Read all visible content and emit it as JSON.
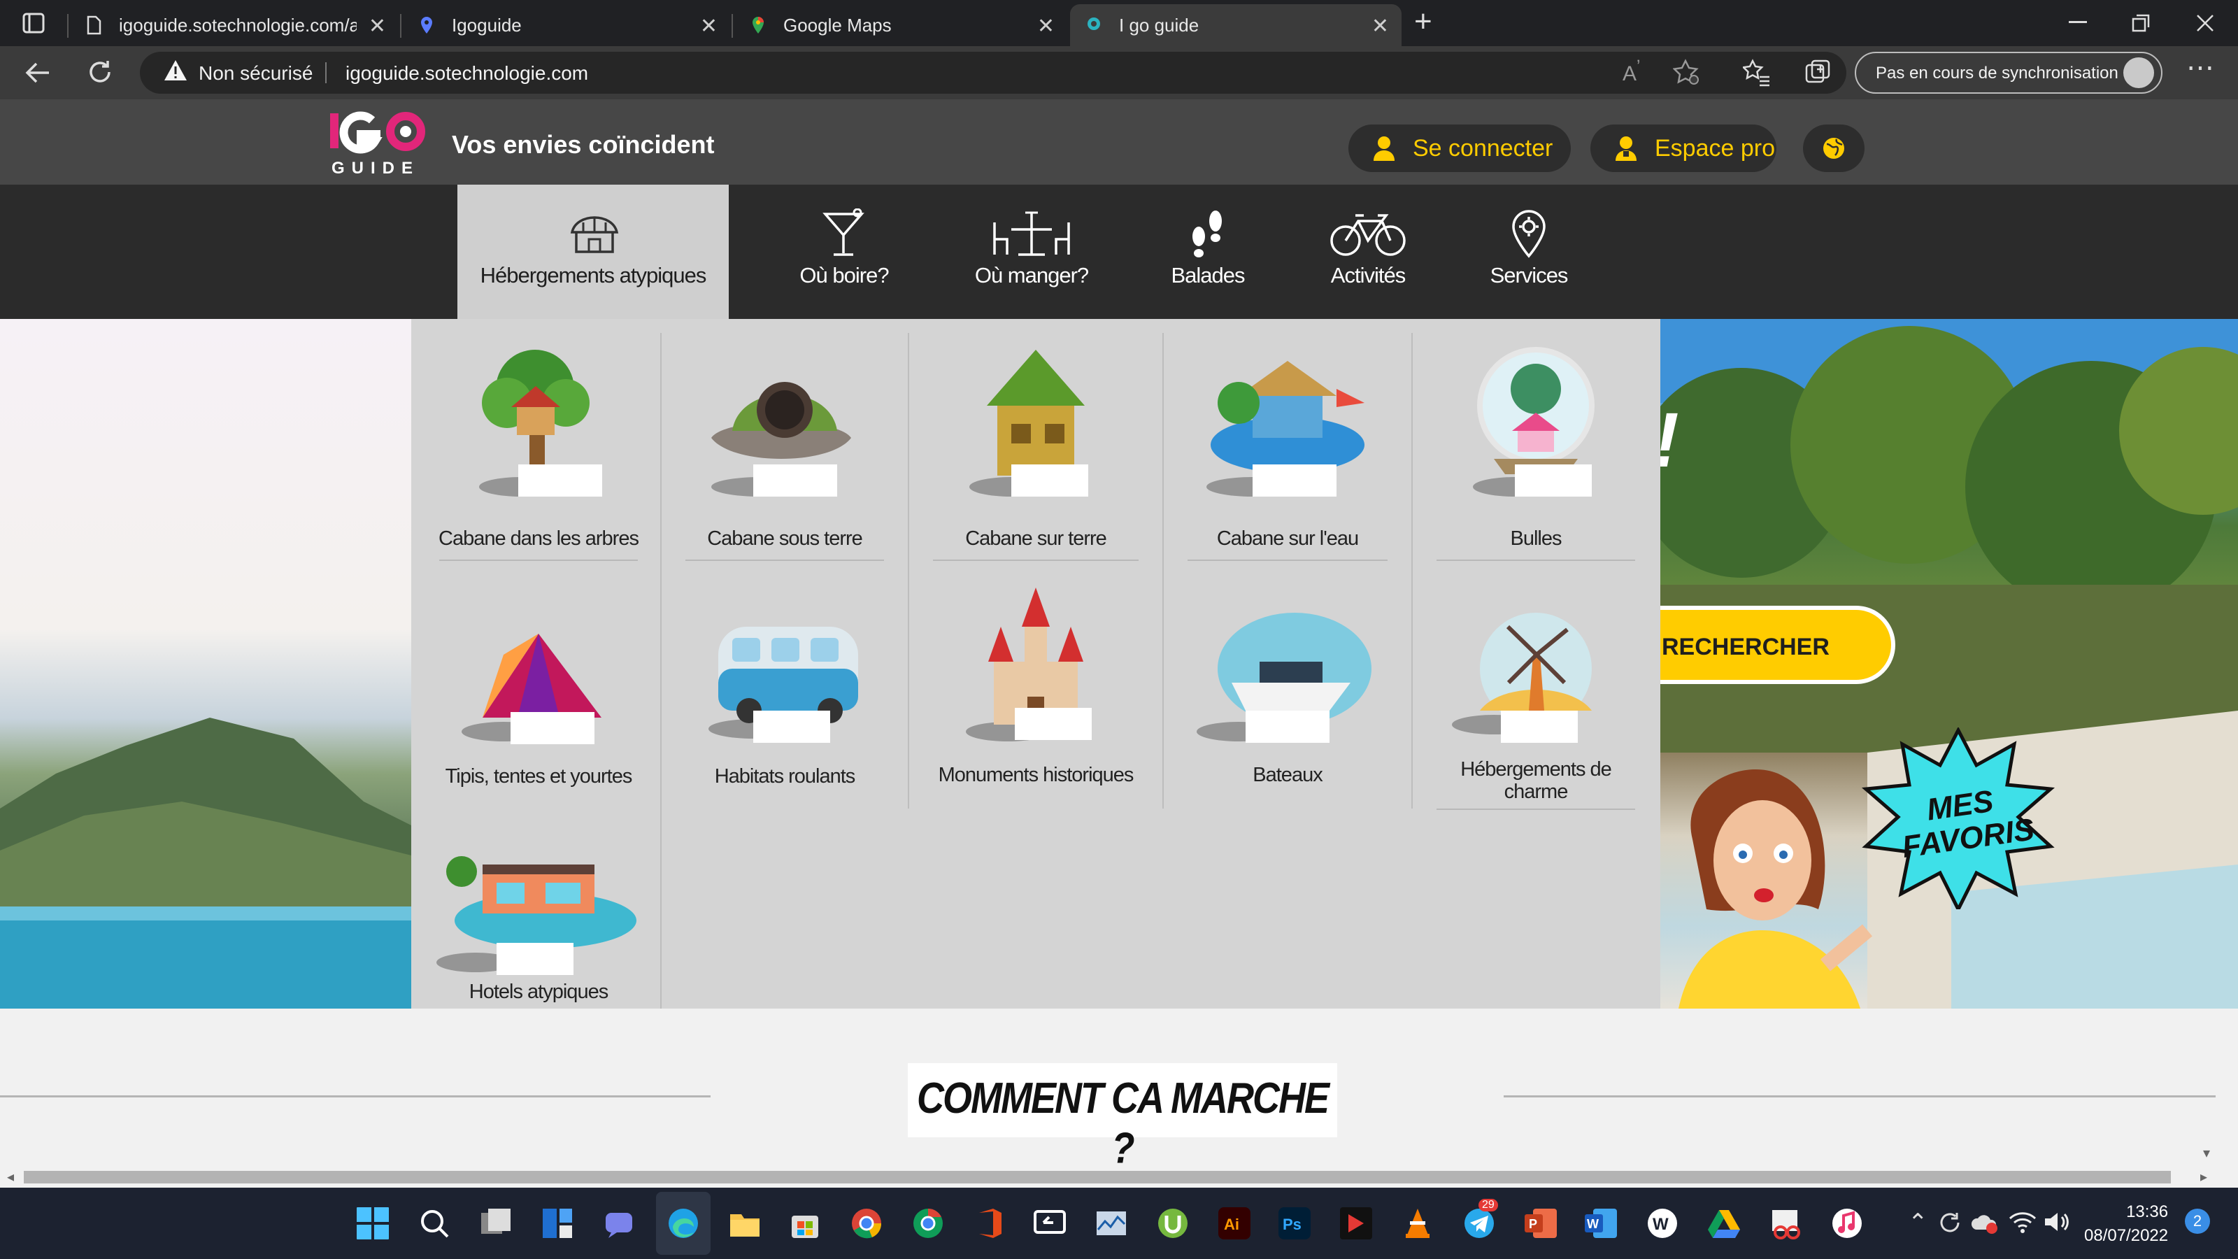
{
  "browser": {
    "tabs": [
      {
        "title": "igoguide.sotechnologie.com/ad",
        "active": false
      },
      {
        "title": "Igoguide",
        "active": false
      },
      {
        "title": "Google Maps",
        "active": false
      },
      {
        "title": "I go guide",
        "active": true
      }
    ],
    "security_label": "Non sécurisé",
    "url": "igoguide.sotechnologie.com",
    "sync_label": "Pas en cours de synchronisation",
    "new_tab_glyph": "+",
    "close_glyph": "✕"
  },
  "site": {
    "tagline": "Vos envies coïncident",
    "login_label": "Se connecter",
    "pro_label": "Espace pro",
    "accent_color": "#ffcc00",
    "nav": [
      {
        "label": "Hébergements atypiques",
        "icon": "cabin-icon",
        "active": true
      },
      {
        "label": "Où boire?",
        "icon": "cocktail-icon",
        "active": false
      },
      {
        "label": "Où manger?",
        "icon": "restaurant-table-icon",
        "active": false
      },
      {
        "label": "Balades",
        "icon": "footprints-icon",
        "active": false
      },
      {
        "label": "Activités",
        "icon": "bicycle-icon",
        "active": false
      },
      {
        "label": "Services",
        "icon": "map-pin-gear-icon",
        "active": false
      }
    ],
    "dropdown": [
      {
        "label": "Cabane dans les arbres",
        "icon": "treehouse-icon"
      },
      {
        "label": "Cabane  sous terre",
        "icon": "underground-cabin-icon"
      },
      {
        "label": "Cabane sur terre",
        "icon": "hut-icon"
      },
      {
        "label": "Cabane  sur l'eau",
        "icon": "water-cabin-icon"
      },
      {
        "label": "Bulles",
        "icon": "bubble-dome-icon"
      },
      {
        "label": "Tipis, tentes et yourtes",
        "icon": "tent-icon"
      },
      {
        "label": "Habitats roulants",
        "icon": "van-icon"
      },
      {
        "label": "Monuments historiques",
        "icon": "castle-icon"
      },
      {
        "label": "Bateaux",
        "icon": "boat-icon"
      },
      {
        "label": "Hébergements de charme",
        "icon": "windmill-icon"
      },
      {
        "label": "Hotels atypiques",
        "icon": "pool-house-icon"
      }
    ],
    "search_label": "RECHERCHER",
    "favorites_label": "MES FAVORIS",
    "how_it_works": "COMMENT CA MARCHE ?"
  },
  "taskbar": {
    "time": "13:36",
    "date": "08/07/2022",
    "notification_count": "2",
    "telegram_badge": "29"
  }
}
